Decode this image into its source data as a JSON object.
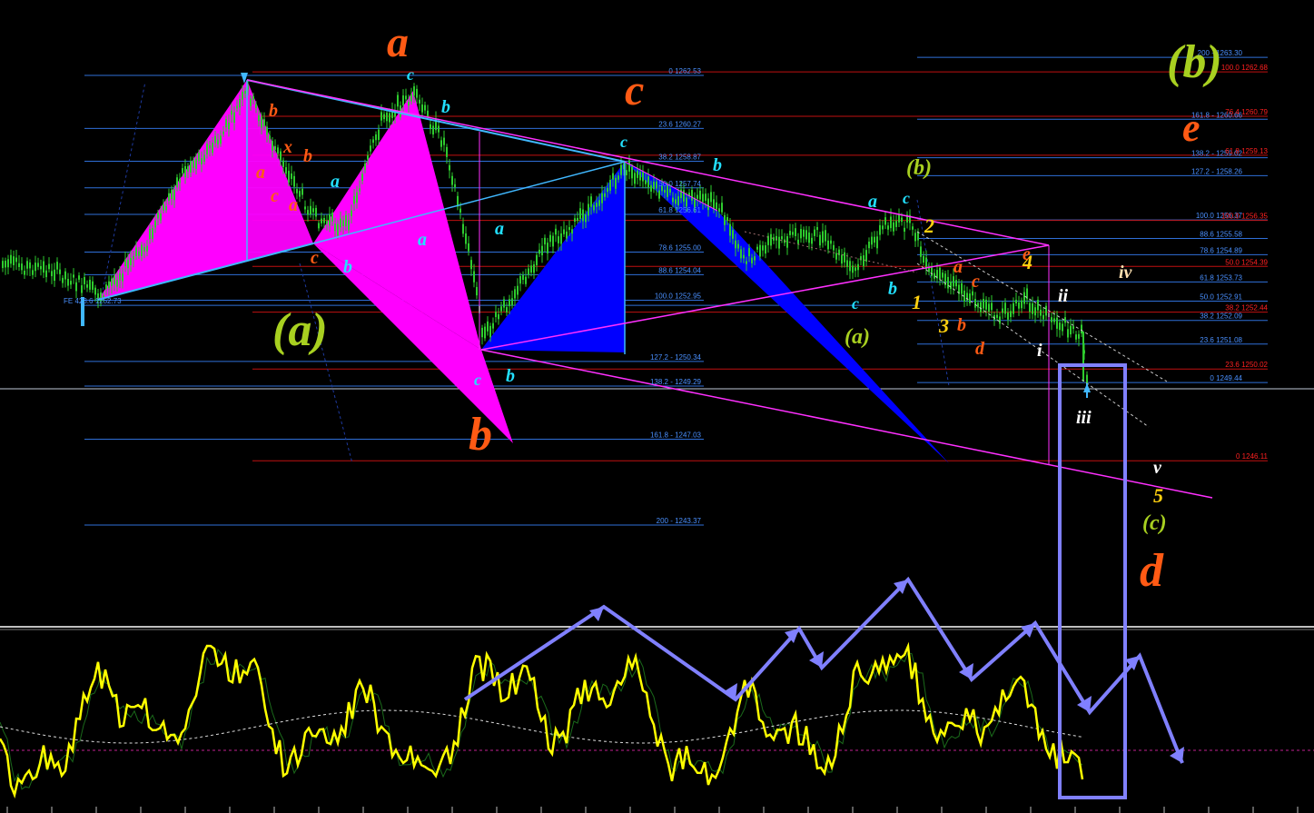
{
  "chart_data": {
    "type": "candlestick",
    "description_levels": "Fibonacci retracement/expansion levels printed on the chart",
    "fib_blue_left": [
      {
        "label": "FE 423.6 1252.73",
        "price": 1252.73
      }
    ],
    "fib_blue_mid": [
      {
        "label": "0 1262.53",
        "price": 1262.53
      },
      {
        "label": "23.6 1260.27",
        "price": 1260.27
      },
      {
        "label": "38.2 1258.87",
        "price": 1258.87
      },
      {
        "label": "50.0 1257.74",
        "price": 1257.74
      },
      {
        "label": "61.8 1256.61",
        "price": 1256.61
      },
      {
        "label": "78.6 1255.00",
        "price": 1255.0
      },
      {
        "label": "88.6 1254.04",
        "price": 1254.04
      },
      {
        "label": "100.0 1252.95",
        "price": 1252.95
      },
      {
        "label": "127.2 - 1250.34",
        "price": 1250.34
      },
      {
        "label": "138.2 - 1249.29",
        "price": 1249.29
      },
      {
        "label": "161.8 - 1247.03",
        "price": 1247.03
      },
      {
        "label": "200 - 1243.37",
        "price": 1243.37
      }
    ],
    "fib_blue_right": [
      {
        "label": "200 - 1263.30",
        "price": 1263.3
      },
      {
        "label": "161.8 - 1260.66",
        "price": 1260.66
      },
      {
        "label": "138.2 - 1259.02",
        "price": 1259.02
      },
      {
        "label": "127.2 - 1258.26",
        "price": 1258.26
      },
      {
        "label": "100.0 1256.37",
        "price": 1256.37
      },
      {
        "label": "88.6 1255.58",
        "price": 1255.58
      },
      {
        "label": "78.6 1254.89",
        "price": 1254.89
      },
      {
        "label": "61.8 1253.73",
        "price": 1253.73
      },
      {
        "label": "50.0 1252.91",
        "price": 1252.91
      },
      {
        "label": "38.2 1252.09",
        "price": 1252.09
      },
      {
        "label": "23.6 1251.08",
        "price": 1251.08
      },
      {
        "label": "0 1249.44",
        "price": 1249.44
      }
    ],
    "fib_red_right": [
      {
        "label": "100.0 1262.68",
        "price": 1262.68
      },
      {
        "label": "76.4 1260.79",
        "price": 1260.79
      },
      {
        "label": "61.8 1259.13",
        "price": 1259.13
      },
      {
        "label": "100.0 1256.35",
        "price": 1256.35
      },
      {
        "label": "50.0 1254.39",
        "price": 1254.39
      },
      {
        "label": "38.2 1252.44",
        "price": 1252.44
      },
      {
        "label": "23.6 1250.02",
        "price": 1250.02
      },
      {
        "label": "0 1246.11",
        "price": 1246.11
      }
    ],
    "current_price": 1249.44
  },
  "wave_labels": {
    "a_big": "a",
    "c_big": "c",
    "b_big": "b",
    "d_big": "d",
    "e_big": "e",
    "A_paren": "(a)",
    "b_paren_big": "(b)",
    "b_paren_small": "(b)",
    "a_paren_small": "(a)",
    "c_paren": "(c)",
    "w1": "1",
    "w2": "2",
    "w3": "3",
    "w4": "4",
    "w5": "5",
    "i": "i",
    "ii": "ii",
    "iii": "iii",
    "iv": "iv",
    "v": "v",
    "a": "a",
    "b": "b",
    "c": "c",
    "x": "x",
    "d": "d",
    "e": "e"
  },
  "colors": {
    "background": "#000000",
    "candle": "#2ecc2e",
    "fib_blue": "#2f6fd8",
    "fib_red": "#d01010",
    "magenta": "#ff00ff",
    "blue_pattern": "#0000ff",
    "trend_cyan": "#40b8ff",
    "oscillator": "#ffff00",
    "arrow_path": "#8080ff",
    "label_orange": "#ff5a14",
    "label_cyan": "#22e0ff",
    "label_olive": "#a8d020",
    "label_yellow": "#ffd010",
    "label_white": "#ffffff"
  }
}
